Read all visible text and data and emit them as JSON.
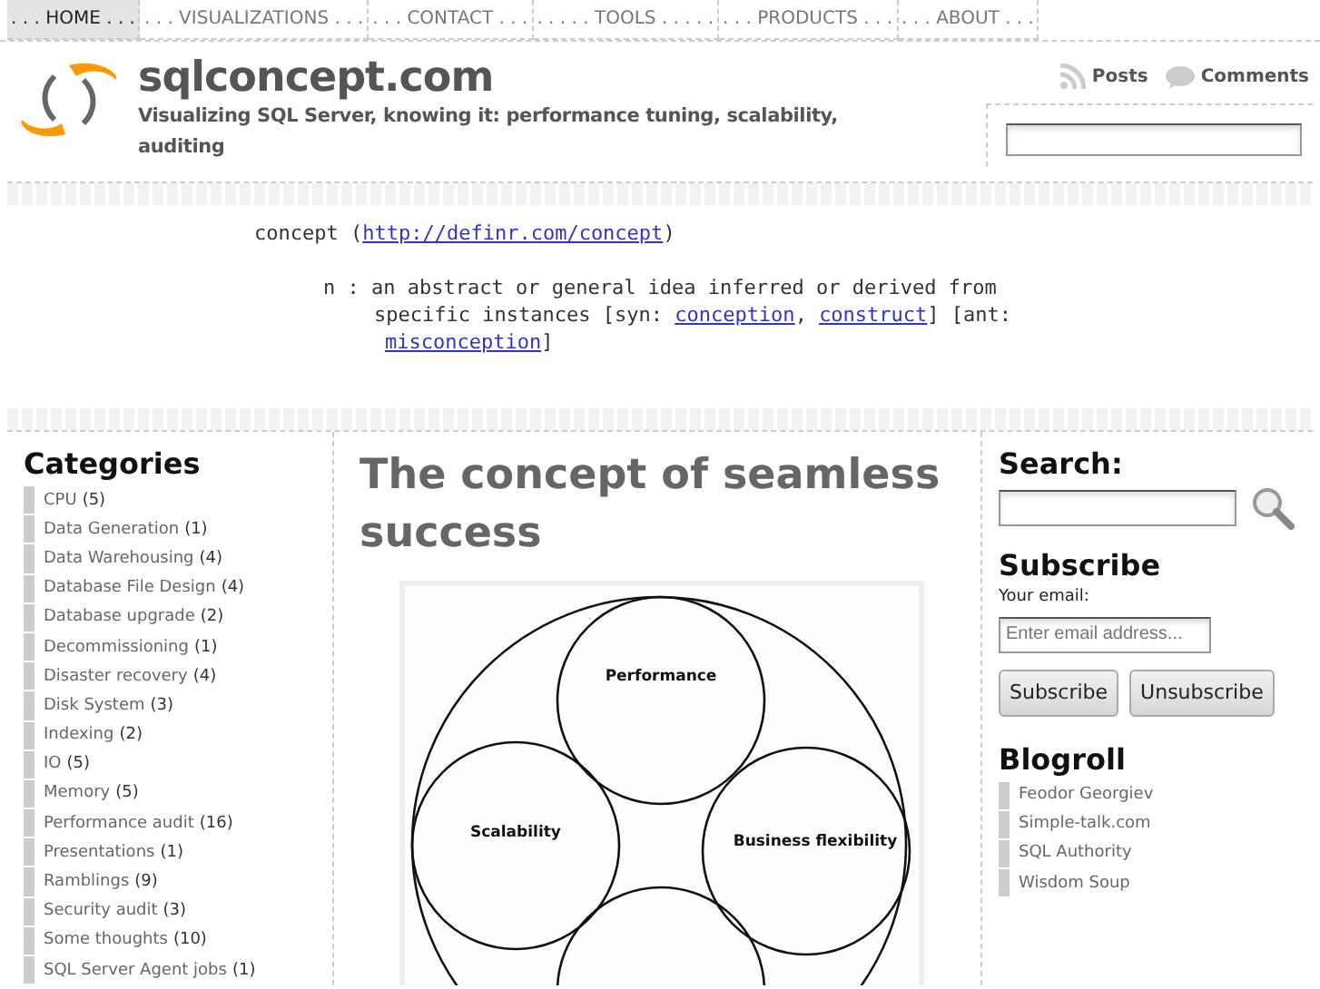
{
  "nav": [
    {
      "label": ". . . HOME . . .",
      "selected": true
    },
    {
      "label": ". . . VISUALIZATIONS . . .",
      "selected": false
    },
    {
      "label": ". . . CONTACT . . .",
      "selected": false
    },
    {
      "label": ". . . . . TOOLS . . . . .",
      "selected": false
    },
    {
      "label": ". . . PRODUCTS . . .",
      "selected": false
    },
    {
      "label": ". . . ABOUT . . .",
      "selected": false
    }
  ],
  "header": {
    "title": "sqlconcept.com",
    "tagline": "Visualizing SQL Server, knowing it: performance tuning, scalability, auditing",
    "feeds": [
      "Posts",
      "Comments"
    ]
  },
  "definition": {
    "lines": [
      [
        {
          "kind": "text",
          "text": "concept ("
        },
        {
          "kind": "link",
          "text": "http://definr.com/concept"
        },
        {
          "kind": "text",
          "text": ")"
        }
      ],
      [
        {
          "kind": "text",
          "text": "n : an abstract or general idea inferred or derived from"
        }
      ],
      [
        {
          "kind": "text",
          "text": "specific instances [syn: "
        },
        {
          "kind": "link",
          "text": "conception"
        },
        {
          "kind": "text",
          "text": ", "
        },
        {
          "kind": "link",
          "text": "construct"
        },
        {
          "kind": "text",
          "text": "] [ant:"
        }
      ],
      [
        {
          "kind": "link",
          "text": "misconception"
        },
        {
          "kind": "text",
          "text": "]"
        }
      ]
    ]
  },
  "categories": {
    "title": "Categories",
    "items": [
      {
        "name": "CPU",
        "count": "(5)"
      },
      {
        "name": "Data Generation",
        "count": "(1)"
      },
      {
        "name": "Data Warehousing",
        "count": "(4)"
      },
      {
        "name": "Database File Design",
        "count": "(4)"
      },
      {
        "name": "Database upgrade",
        "count": "(2)"
      },
      {
        "name": "Decommissioning",
        "count": "(1)"
      },
      {
        "name": "Disaster recovery",
        "count": "(4)"
      },
      {
        "name": "Disk System",
        "count": "(3)"
      },
      {
        "name": "Indexing",
        "count": "(2)"
      },
      {
        "name": "IO",
        "count": "(5)"
      },
      {
        "name": "Memory",
        "count": "(5)"
      },
      {
        "name": "Performance audit",
        "count": "(16)"
      },
      {
        "name": "Presentations",
        "count": "(1)"
      },
      {
        "name": "Ramblings",
        "count": "(9)"
      },
      {
        "name": "Security audit",
        "count": "(3)"
      },
      {
        "name": "Some thoughts",
        "count": "(10)"
      },
      {
        "name": "SQL Server Agent jobs",
        "count": "(1)"
      }
    ]
  },
  "post": {
    "title": "The concept of seamless success",
    "diagram_labels": [
      "Performance",
      "Scalability",
      "Business flexibility"
    ]
  },
  "sidebar": {
    "search_title": "Search:",
    "subscribe_title": "Subscribe",
    "email_label": "Your email:",
    "email_placeholder": "Enter email address...",
    "buttons": [
      "Subscribe",
      "Unsubscribe"
    ],
    "blogroll_title": "Blogroll",
    "blogroll": [
      "Feodor Georgiev",
      "Simple-talk.com",
      "SQL Authority",
      "Wisdom Soup"
    ]
  }
}
